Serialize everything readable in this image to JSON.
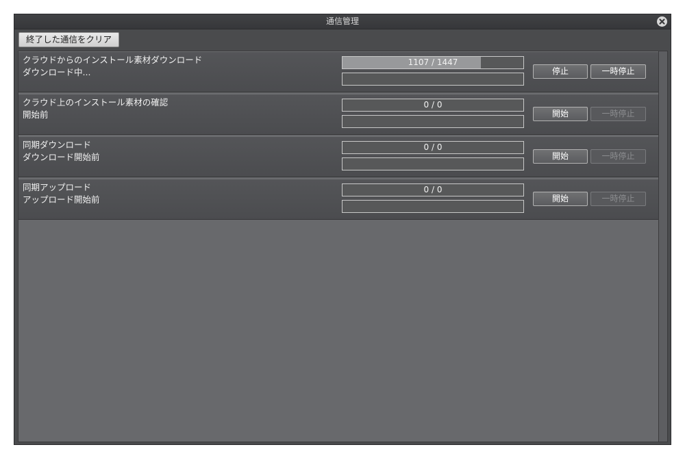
{
  "window": {
    "title": "通信管理",
    "close_icon": "close-icon"
  },
  "toolbar": {
    "clear_label": "終了した通信をクリア"
  },
  "rows": [
    {
      "name": "クラウドからのインストール素材ダウンロード",
      "status": "ダウンロード中...",
      "progress_text": "1107 / 1447",
      "progress_fraction": 0.765,
      "primary_label": "停止",
      "pause_label": "一時停止",
      "pause_enabled": true
    },
    {
      "name": "クラウド上のインストール素材の確認",
      "status": "開始前",
      "progress_text": "0 / 0",
      "progress_fraction": 0,
      "primary_label": "開始",
      "pause_label": "一時停止",
      "pause_enabled": false
    },
    {
      "name": "同期ダウンロード",
      "status": "ダウンロード開始前",
      "progress_text": "0 / 0",
      "progress_fraction": 0,
      "primary_label": "開始",
      "pause_label": "一時停止",
      "pause_enabled": false
    },
    {
      "name": "同期アップロード",
      "status": "アップロード開始前",
      "progress_text": "0 / 0",
      "progress_fraction": 0,
      "primary_label": "開始",
      "pause_label": "一時停止",
      "pause_enabled": false
    }
  ]
}
